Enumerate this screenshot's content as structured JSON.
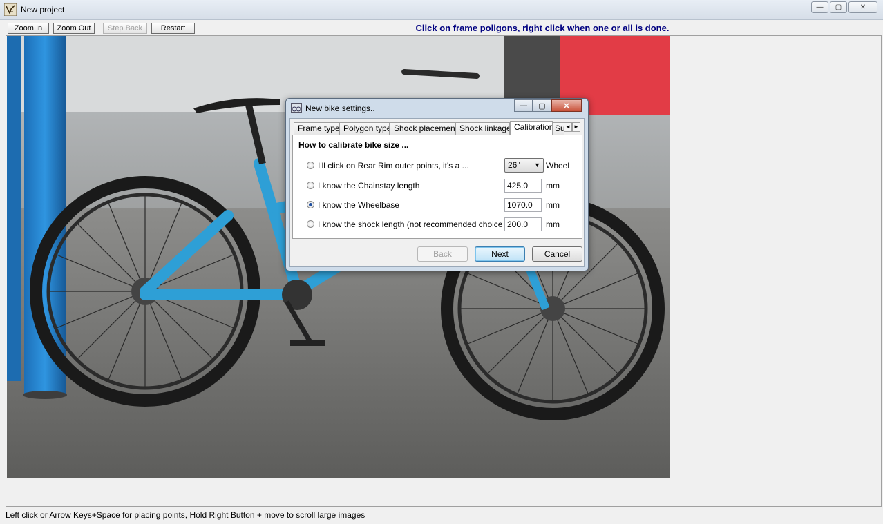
{
  "window": {
    "title": "New project",
    "controls": {
      "minimize": "—",
      "maximize": "▢",
      "close": "✕"
    }
  },
  "toolbar": {
    "zoom_in": "Zoom In",
    "zoom_out": "Zoom Out",
    "step_back": "Step Back",
    "restart": "Restart",
    "instruction": "Click on frame poligons, right click when one or all is done."
  },
  "status": {
    "text": "Left click or Arrow Keys+Space for placing points, Hold Right Button + move to scroll large images"
  },
  "dialog": {
    "title": "New bike settings..",
    "tabs": [
      {
        "label": "Frame type"
      },
      {
        "label": "Polygon type"
      },
      {
        "label": "Shock placement"
      },
      {
        "label": "Shock linkage"
      },
      {
        "label": "Calibration"
      },
      {
        "label": "Su"
      }
    ],
    "section_title": "How to calibrate bike size ...",
    "options": [
      {
        "label": "I'll click on Rear Rim outer points, it's a ...",
        "value": "26''",
        "unit": "Wheel",
        "checked": false
      },
      {
        "label": "I know the Chainstay length",
        "value": "425.0",
        "unit": "mm",
        "checked": false
      },
      {
        "label": "I know the Wheelbase",
        "value": "1070.0",
        "unit": "mm",
        "checked": true
      },
      {
        "label": "I know the shock length (not recommended choice",
        "value": "200.0",
        "unit": "mm",
        "checked": false
      }
    ],
    "buttons": {
      "back": "Back",
      "next": "Next",
      "cancel": "Cancel"
    }
  },
  "colors": {
    "instruction": "#000080",
    "frame_blue": "#2e9fd6"
  }
}
